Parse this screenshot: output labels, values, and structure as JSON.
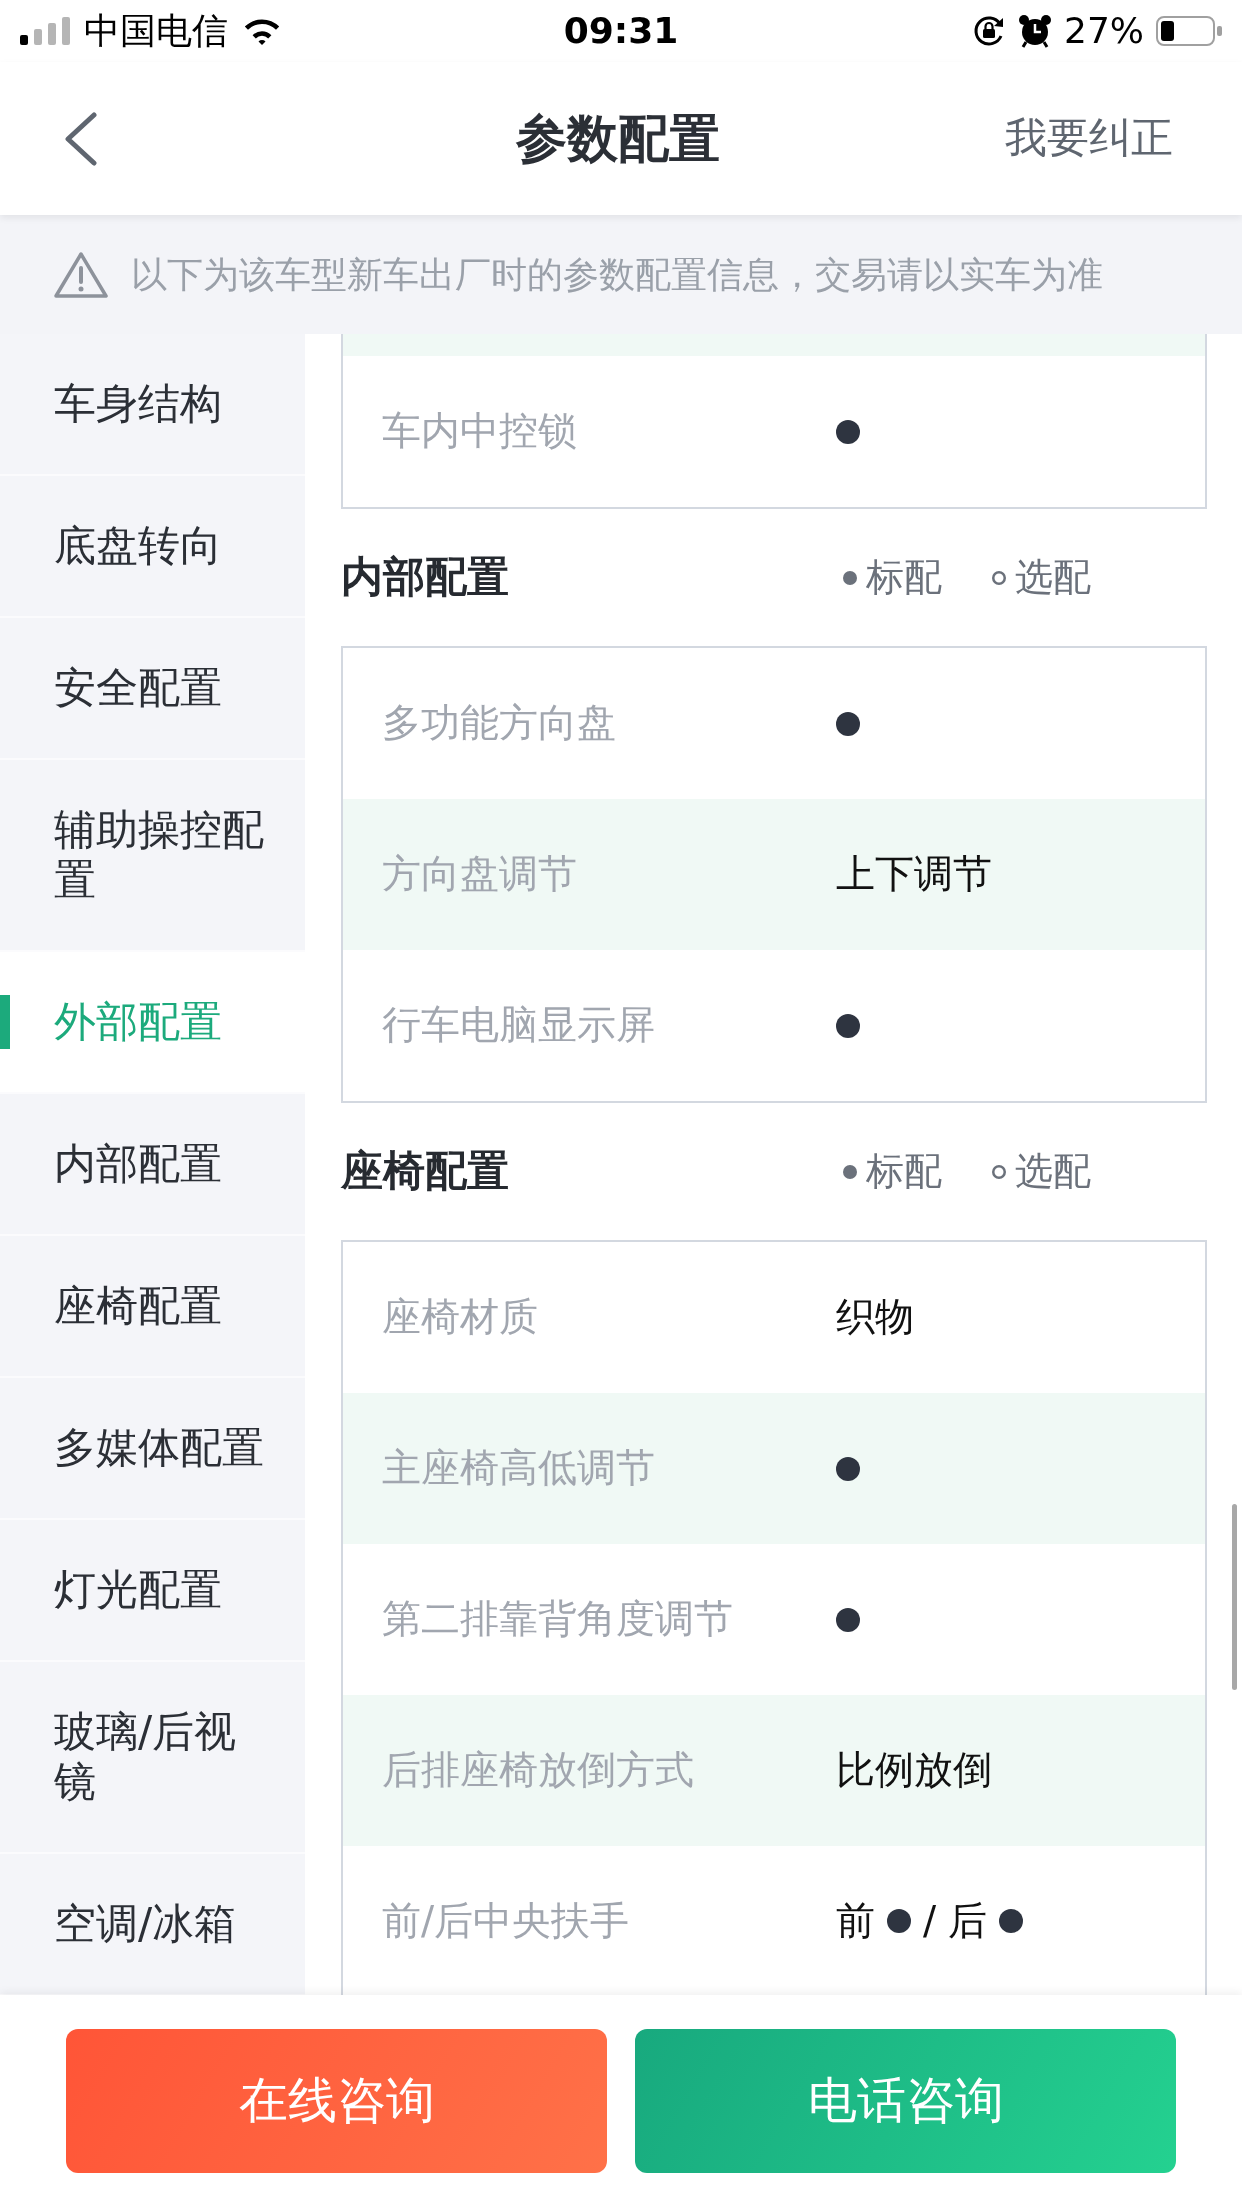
{
  "status_bar": {
    "carrier": "中国电信",
    "time": "09:31",
    "battery": "27%"
  },
  "nav_bar": {
    "title": "参数配置",
    "action": "我要纠正"
  },
  "notice": {
    "text": "以下为该车型新车出厂时的参数配置信息，交易请以实车为准"
  },
  "sidebar": {
    "items": [
      {
        "label": "车身结构",
        "selected": false
      },
      {
        "label": "底盘转向",
        "selected": false
      },
      {
        "label": "安全配置",
        "selected": false
      },
      {
        "label": "辅助操控配置",
        "selected": false
      },
      {
        "label": "外部配置",
        "selected": true
      },
      {
        "label": "内部配置",
        "selected": false
      },
      {
        "label": "座椅配置",
        "selected": false
      },
      {
        "label": "多媒体配置",
        "selected": false
      },
      {
        "label": "灯光配置",
        "selected": false
      },
      {
        "label": "玻璃/后视镜",
        "selected": false
      },
      {
        "label": "空调/冰箱",
        "selected": false
      }
    ]
  },
  "sections": [
    {
      "rows": [
        {
          "kind": "cut",
          "shaded": true
        },
        {
          "kind": "spec",
          "label": "车内中控锁",
          "shaded": false,
          "value": [
            {
              "kind": "standard"
            }
          ]
        }
      ]
    },
    {
      "title": "内部配置",
      "legend": [
        {
          "kind": "standard",
          "label": "标配"
        },
        {
          "kind": "optional",
          "label": "选配"
        }
      ],
      "rows": [
        {
          "kind": "spec",
          "label": "多功能方向盘",
          "shaded": false,
          "value": [
            {
              "kind": "standard"
            }
          ]
        },
        {
          "kind": "spec",
          "label": "方向盘调节",
          "shaded": true,
          "value": [
            {
              "kind": "text",
              "text": "上下调节"
            }
          ]
        },
        {
          "kind": "spec",
          "label": "行车电脑显示屏",
          "shaded": false,
          "value": [
            {
              "kind": "standard"
            }
          ]
        }
      ]
    },
    {
      "title": "座椅配置",
      "legend": [
        {
          "kind": "standard",
          "label": "标配"
        },
        {
          "kind": "optional",
          "label": "选配"
        }
      ],
      "rows": [
        {
          "kind": "spec",
          "label": "座椅材质",
          "shaded": false,
          "value": [
            {
              "kind": "text",
              "text": "织物"
            }
          ]
        },
        {
          "kind": "spec",
          "label": "主座椅高低调节",
          "shaded": true,
          "value": [
            {
              "kind": "standard"
            }
          ]
        },
        {
          "kind": "spec",
          "label": "第二排靠背角度调节",
          "shaded": false,
          "value": [
            {
              "kind": "standard"
            }
          ]
        },
        {
          "kind": "spec",
          "label": "后排座椅放倒方式",
          "shaded": true,
          "value": [
            {
              "kind": "text",
              "text": "比例放倒"
            }
          ]
        },
        {
          "kind": "spec",
          "label": "前/后中央扶手",
          "shaded": false,
          "value": [
            {
              "kind": "text",
              "text": "前"
            },
            {
              "kind": "standard"
            },
            {
              "kind": "text",
              "text": "/"
            },
            {
              "kind": "text",
              "text": "后"
            },
            {
              "kind": "standard"
            }
          ]
        }
      ]
    }
  ],
  "buttons": [
    {
      "kind": "online",
      "label": "在线咨询"
    },
    {
      "kind": "phone",
      "label": "电话咨询"
    }
  ]
}
